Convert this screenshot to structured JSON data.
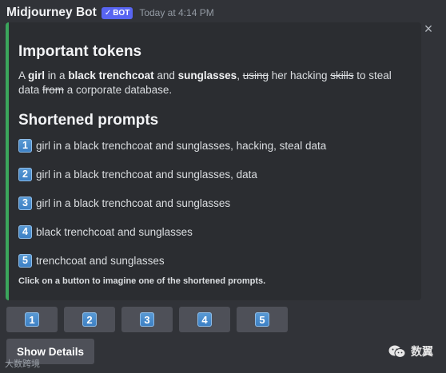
{
  "header": {
    "username": "Midjourney Bot",
    "badge": "BOT",
    "badge_check": "✓",
    "timestamp": "Today at 4:14 PM"
  },
  "embed": {
    "accent_color": "#3ba55c",
    "close_icon": "×",
    "important_title": "Important tokens",
    "tokens": {
      "t1": "A ",
      "t2": "girl",
      "t3": " in a ",
      "t4": "black trenchcoat",
      "t5": " and ",
      "t6": "sunglasses",
      "t7": ", ",
      "t8": "using",
      "t9": " her hacking ",
      "t10": "skills",
      "t11": " to steal data ",
      "t12": "from",
      "t13": " a corporate database."
    },
    "shortened_title": "Shortened prompts",
    "prompts": [
      {
        "num": "1",
        "text": "girl in a black trenchcoat and sunglasses, hacking, steal data"
      },
      {
        "num": "2",
        "text": "girl in a black trenchcoat and sunglasses, data"
      },
      {
        "num": "3",
        "text": "girl in a black trenchcoat and sunglasses"
      },
      {
        "num": "4",
        "text": "black trenchcoat and sunglasses"
      },
      {
        "num": "5",
        "text": "trenchcoat and sunglasses"
      }
    ],
    "footer": "Click on a button to imagine one of the shortened prompts."
  },
  "buttons": [
    "1",
    "2",
    "3",
    "4",
    "5"
  ],
  "show_details": "Show Details",
  "watermark_left": "大数跨境",
  "watermark_right": "数翼"
}
